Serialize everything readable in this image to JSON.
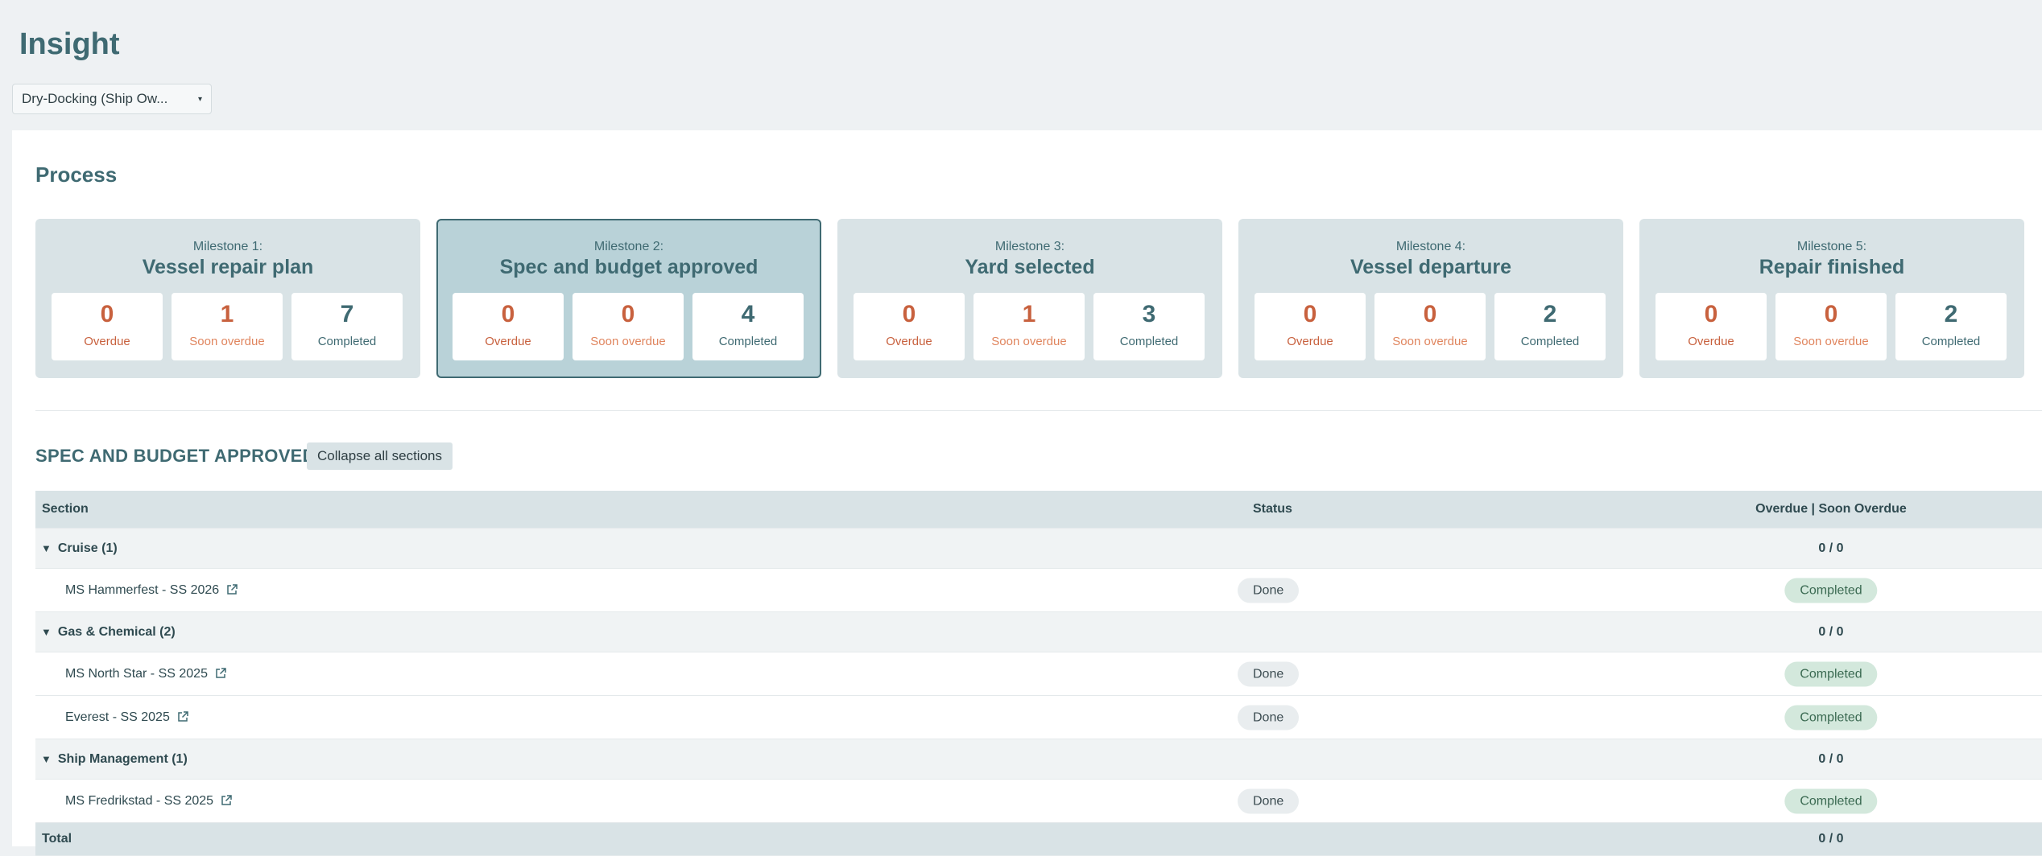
{
  "header": {
    "title": "Insight",
    "dropdown_value": "Dry-Docking (Ship Ow..."
  },
  "process": {
    "title": "Process",
    "milestones": [
      {
        "number": "Milestone 1:",
        "name": "Vessel repair plan",
        "overdue": "0",
        "soon_overdue": "1",
        "completed": "7"
      },
      {
        "number": "Milestone 2:",
        "name": "Spec and budget approved",
        "overdue": "0",
        "soon_overdue": "0",
        "completed": "4"
      },
      {
        "number": "Milestone 3:",
        "name": "Yard selected",
        "overdue": "0",
        "soon_overdue": "1",
        "completed": "3"
      },
      {
        "number": "Milestone 4:",
        "name": "Vessel departure",
        "overdue": "0",
        "soon_overdue": "0",
        "completed": "2"
      },
      {
        "number": "Milestone 5:",
        "name": "Repair finished",
        "overdue": "0",
        "soon_overdue": "0",
        "completed": "2"
      }
    ],
    "labels": {
      "overdue": "Overdue",
      "soon_overdue": "Soon overdue",
      "completed": "Completed"
    }
  },
  "detail": {
    "title": "SPEC AND BUDGET APPROVED",
    "collapse_label": "Collapse all sections",
    "columns": {
      "section": "Section",
      "status": "Status",
      "overdue": "Overdue | Soon Overdue"
    },
    "groups": [
      {
        "label": "Cruise (1)",
        "overdue": "0 / 0",
        "items": [
          {
            "name": "MS Hammerfest - SS 2026",
            "status": "Done",
            "overdue": "Completed"
          }
        ]
      },
      {
        "label": "Gas & Chemical (2)",
        "overdue": "0 / 0",
        "items": [
          {
            "name": "MS North Star - SS 2025",
            "status": "Done",
            "overdue": "Completed"
          },
          {
            "name": "Everest - SS 2025",
            "status": "Done",
            "overdue": "Completed"
          }
        ]
      },
      {
        "label": "Ship Management (1)",
        "overdue": "0 / 0",
        "items": [
          {
            "name": "MS Fredrikstad - SS 2025",
            "status": "Done",
            "overdue": "Completed"
          }
        ]
      }
    ],
    "total": {
      "label": "Total",
      "overdue": "0 / 0"
    }
  },
  "colors": {
    "accent": "#3f6a72",
    "overdue": "#c8613e",
    "card_bg": "#d9e3e6",
    "completed_pill": "#d3e8dc"
  }
}
